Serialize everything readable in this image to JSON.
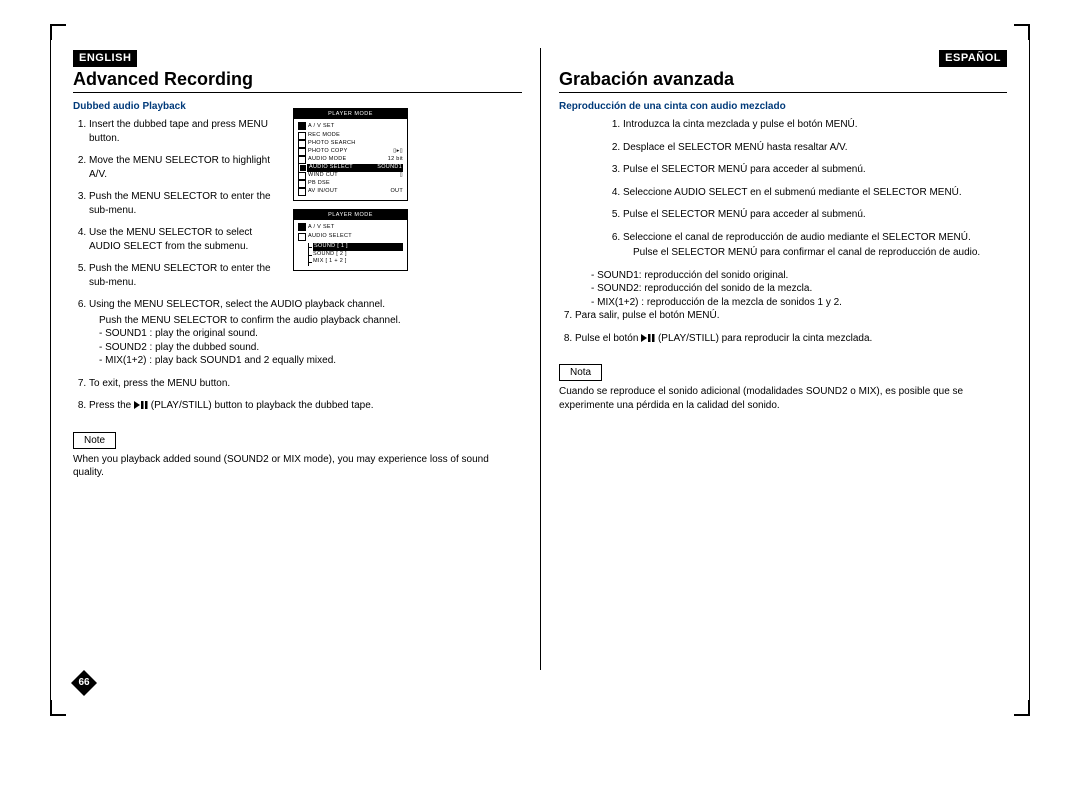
{
  "page_number": "66",
  "left": {
    "lang": "ENGLISH",
    "title": "Advanced Recording",
    "subtitle": "Dubbed audio Playback",
    "steps": {
      "s1": "Insert the dubbed tape and press MENU button.",
      "s2": "Move the MENU SELECTOR to highlight A/V.",
      "s3": "Push the MENU SELECTOR to enter the sub-menu.",
      "s4": "Use the MENU SELECTOR to select AUDIO SELECT from the submenu.",
      "s5": "Push the MENU SELECTOR to enter the sub-menu.",
      "s6": "Using the MENU SELECTOR, select the AUDIO playback channel.",
      "s6a": "Push the MENU SELECTOR to confirm the audio playback channel.",
      "s6b": "- SOUND1 : play the original sound.",
      "s6c": "- SOUND2 : play the dubbed sound.",
      "s6d": "- MIX(1+2) : play back SOUND1 and 2 equally mixed.",
      "s7": "To exit, press the MENU button.",
      "s8a": "Press the ",
      "s8b": " (PLAY/STILL) button to playback the dubbed tape."
    },
    "note_label": "Note",
    "note_text": "When you playback added sound (SOUND2 or MIX mode), you may experience loss of sound quality."
  },
  "right": {
    "lang": "ESPAÑOL",
    "title": "Grabación avanzada",
    "subtitle": "Reproducción de una cinta con audio mezclado",
    "steps": {
      "s1": "Introduzca la cinta mezclada y pulse el botón MENÚ.",
      "s2": "Desplace el SELECTOR MENÚ hasta resaltar A/V.",
      "s3": "Pulse el SELECTOR MENÚ para acceder al submenú.",
      "s4": "Seleccione AUDIO SELECT en el submenú mediante el SELECTOR MENÚ.",
      "s5": "Pulse el SELECTOR MENÚ para acceder al submenú.",
      "s6": "Seleccione el canal de reproducción de audio mediante el SELECTOR MENÚ.",
      "s6a": "Pulse el SELECTOR MENÚ para confirmar el canal de reproducción de audio.",
      "s6b": "- SOUND1: reproducción del sonido original.",
      "s6c": "- SOUND2: reproducción del sonido de la mezcla.",
      "s6d": "- MIX(1+2) : reproducción de la mezcla de sonidos 1 y 2.",
      "s7": "Para salir, pulse el botón MENÚ.",
      "s8a": "Pulse el botón ",
      "s8b": " (PLAY/STILL) para reproducir la cinta mezclada."
    },
    "note_label": "Nota",
    "note_text": "Cuando se reproduce el sonido adicional (modalidades SOUND2 o MIX), es posible que se experimente una pérdida en la calidad del sonido."
  },
  "osd": {
    "title": "PLAYER  MODE",
    "section": "A / V  SET",
    "rec_mode": "REC MODE",
    "photo_search": "PHOTO SEARCH",
    "photocopy": "PHOTO COPY",
    "audio_mode": "AUDIO MODE",
    "audio_mode_val": "12 bit",
    "audio_select": "AUDIO SELECT",
    "audio_select_val": "SOUND1",
    "wind_cut": "WIND CUT",
    "pb_dse": "PB DSE",
    "av_inout": "AV IN/OUT",
    "av_inout_val": "OUT",
    "sound1": "SOUND [ 1 ]",
    "sound2": "SOUND [ 2 ]",
    "mix": "MIX [ 1 + 2 ]"
  }
}
